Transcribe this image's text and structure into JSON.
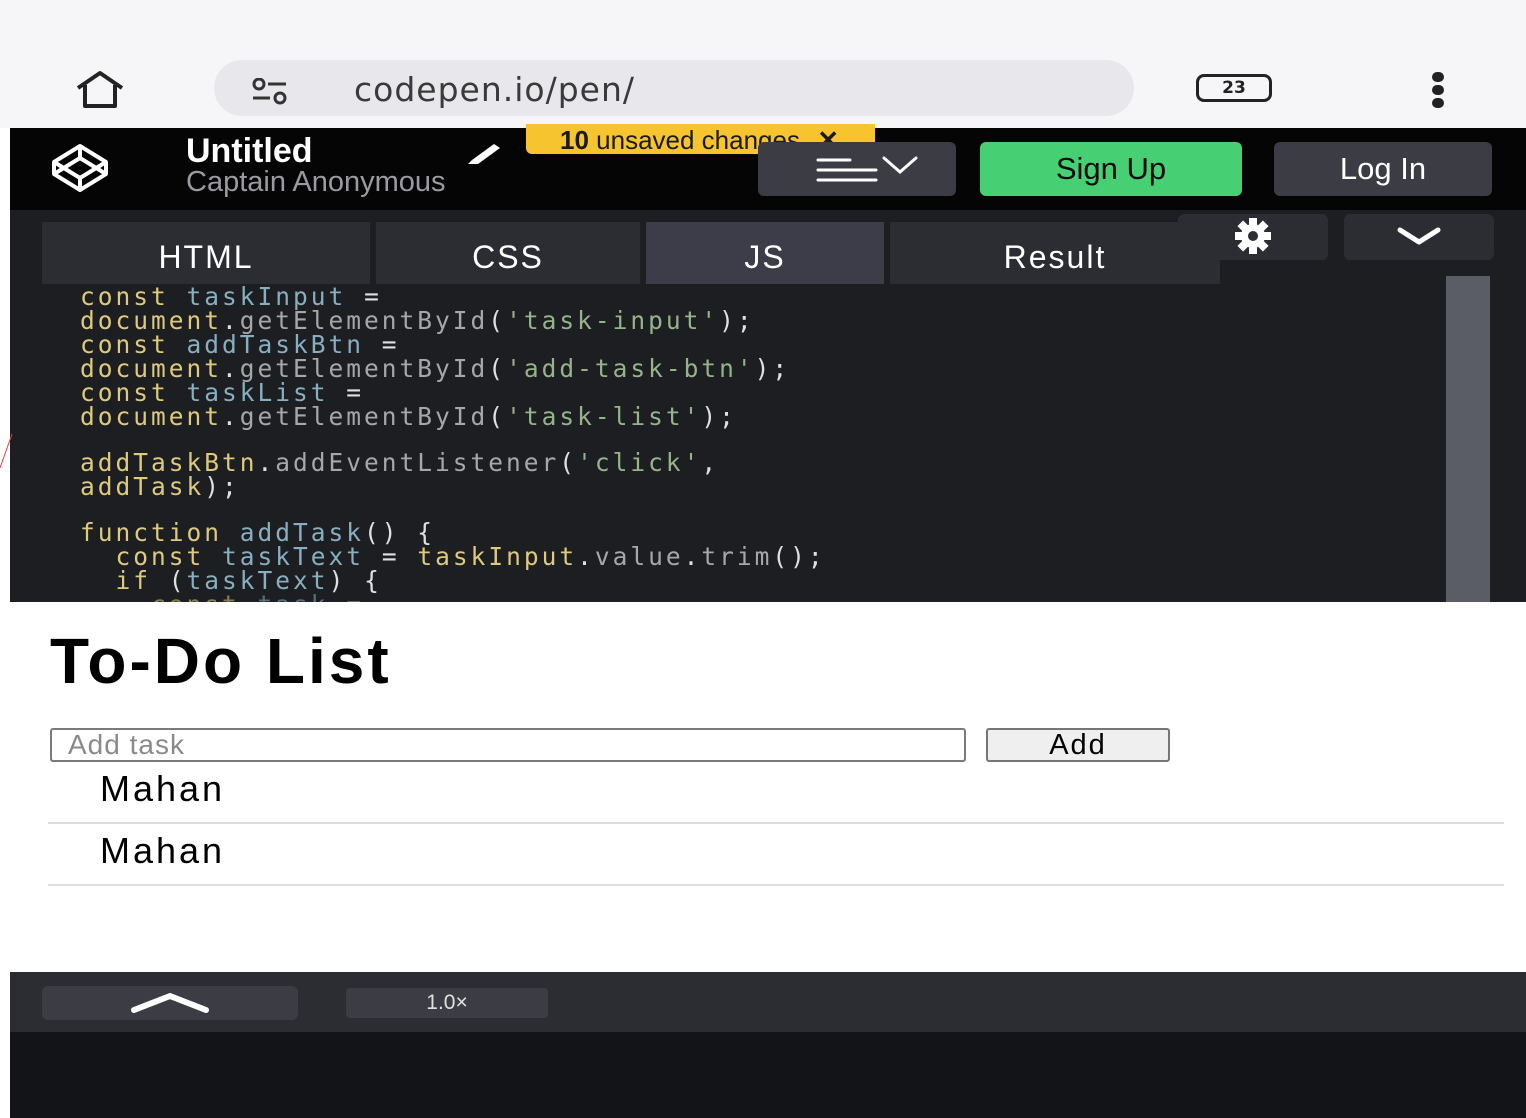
{
  "browser": {
    "url": "codepen.io/pen/",
    "tab_count": "23",
    "icons": {
      "home": "home-icon",
      "site_info": "site-settings-icon",
      "menu": "more-vert-icon"
    }
  },
  "header": {
    "pen_title": "Untitled",
    "author": "Captain Anonymous",
    "unsaved_count": "10",
    "unsaved_text": "unsaved changes",
    "unsaved_close": "✕",
    "signup_label": "Sign Up",
    "login_label": "Log In",
    "colors": {
      "signup": "#47cf73",
      "badge": "#f6c42f",
      "header_bg": "#050505"
    }
  },
  "editor": {
    "tabs": [
      {
        "label": "HTML"
      },
      {
        "label": "CSS"
      },
      {
        "label": "JS"
      },
      {
        "label": "Result"
      }
    ],
    "active_tab": "JS",
    "code_lines": [
      "const taskInput =",
      "document.getElementById('task-input');",
      "const addTaskBtn =",
      "document.getElementById('add-task-btn');",
      "const taskList =",
      "document.getElementById('task-list');",
      "addTaskBtn.addEventListener('click',",
      "addTask);",
      "function addTask() {",
      "  const taskText = taskInput.value.trim();",
      "  if (taskText) {",
      "    const task ="
    ]
  },
  "result": {
    "title": "To-Do List",
    "input_placeholder": "Add task",
    "add_button": "Add",
    "tasks": [
      "Mahan",
      "Mahan"
    ]
  },
  "bottom": {
    "zoom": "1.0×"
  }
}
